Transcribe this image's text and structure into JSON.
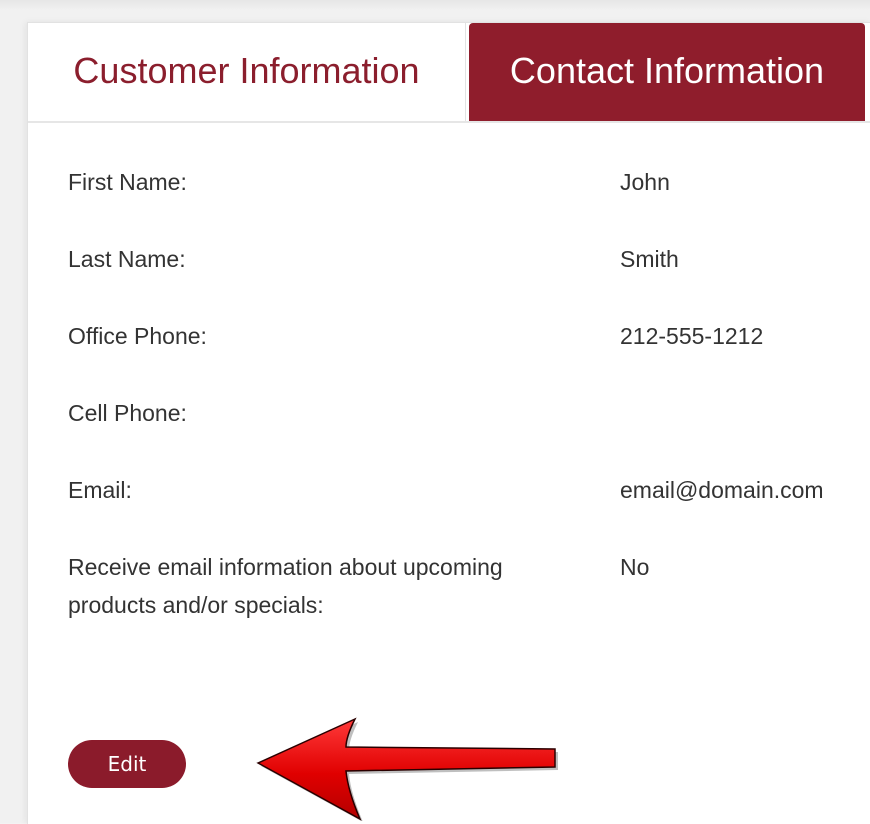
{
  "tabs": {
    "customer_label": "Customer Information",
    "contact_label": "Contact Information",
    "active": "Contact Information"
  },
  "contact": {
    "rows": [
      {
        "label": "First Name:",
        "value": "John"
      },
      {
        "label": "Last Name:",
        "value": "Smith"
      },
      {
        "label": "Office Phone:",
        "value": "212-555-1212"
      },
      {
        "label": "Cell Phone:",
        "value": ""
      },
      {
        "label": "Email:",
        "value": "email@domain.com"
      },
      {
        "label": "Receive email information about upcoming products and/or specials:",
        "value": "No"
      }
    ]
  },
  "actions": {
    "edit_label": "Edit"
  },
  "colors": {
    "brand": "#8f1d2c",
    "arrow": "#e00000",
    "text": "#333333"
  },
  "icons": {
    "annotation": "red-arrow-icon"
  }
}
